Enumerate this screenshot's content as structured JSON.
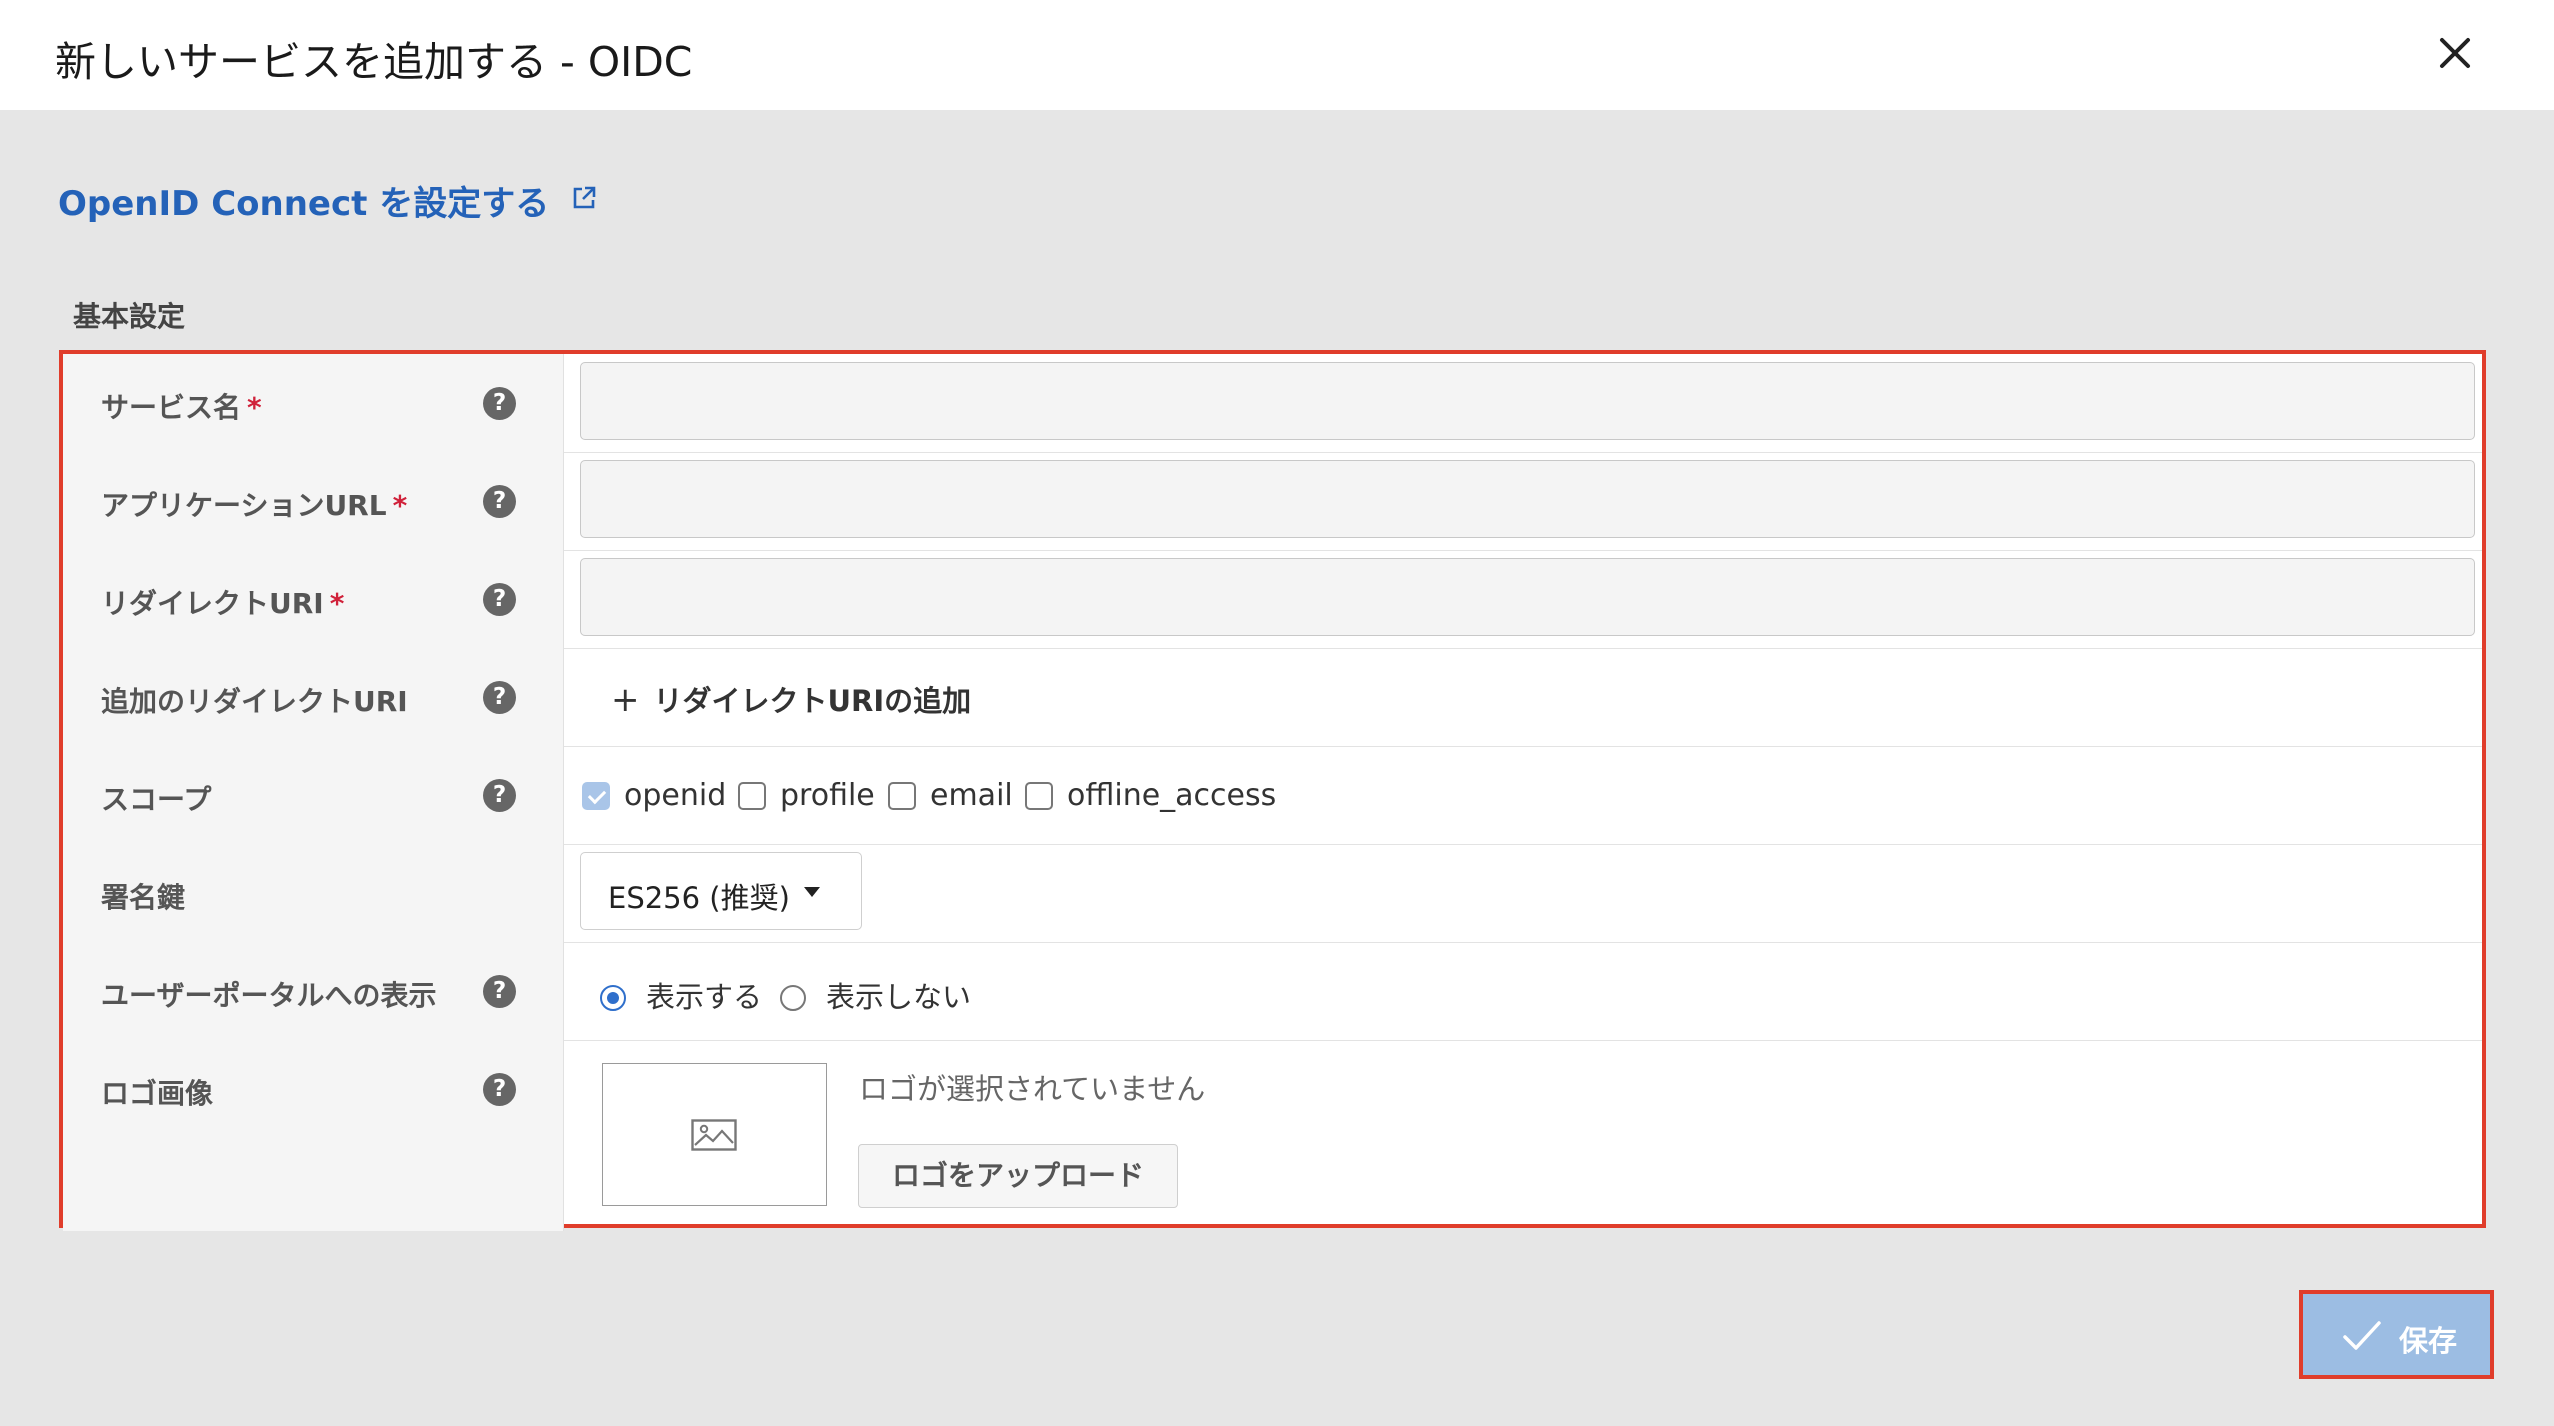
{
  "dialog": {
    "title": "新しいサービスを追加する - OIDC",
    "close_icon": "close-icon"
  },
  "doc_link": {
    "label": "OpenID Connect を設定する",
    "icon": "external-link-icon"
  },
  "basic_settings": {
    "section_label": "基本設定",
    "required_mark": "*",
    "help_icon_glyph": "?",
    "service_name": {
      "label": "サービス名",
      "value": ""
    },
    "application_url": {
      "label": "アプリケーションURL",
      "value": ""
    },
    "redirect_uri": {
      "label": "リダイレクトURI",
      "value": ""
    },
    "additional_redirect_uri": {
      "label": "追加のリダイレクトURI",
      "add_button": "リダイレクトURIの追加",
      "add_icon": "plus-icon",
      "plus_glyph": "+"
    },
    "scope": {
      "label": "スコープ",
      "options": [
        {
          "label": "openid",
          "checked": true,
          "disabled": true
        },
        {
          "label": "profile",
          "checked": false
        },
        {
          "label": "email",
          "checked": false
        },
        {
          "label": "offline_access",
          "checked": false
        }
      ]
    },
    "signing_key": {
      "label": "署名鍵",
      "selected": "ES256 (推奨)"
    },
    "user_portal_display": {
      "label": "ユーザーポータルへの表示",
      "options": [
        {
          "label": "表示する",
          "checked": true
        },
        {
          "label": "表示しない",
          "checked": false
        }
      ]
    },
    "logo": {
      "label": "ロゴ画像",
      "status": "ロゴが選択されていません",
      "upload_button": "ロゴをアップロード",
      "placeholder_icon": "image-icon"
    }
  },
  "footer": {
    "save_label": "保存",
    "save_icon": "checkmark-icon"
  },
  "colors": {
    "accent_blue": "#2462b8",
    "highlight_red": "#e03d2b",
    "save_button": "#9cbde3",
    "required": "#d0213a"
  }
}
